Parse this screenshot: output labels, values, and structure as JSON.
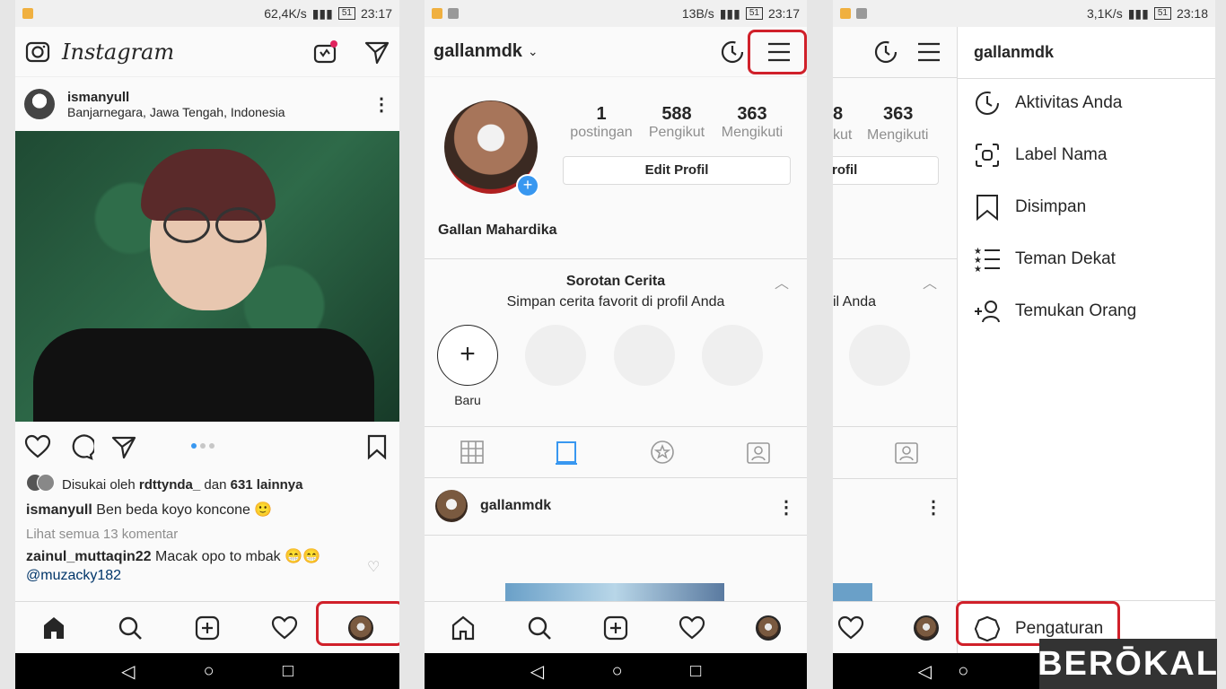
{
  "panel1": {
    "status": {
      "speed": "62,4K/s",
      "battery": "51",
      "time": "23:17"
    },
    "header": {
      "logo": "Instagram"
    },
    "post": {
      "username": "ismanyull",
      "location": "Banjarnegara, Jawa Tengah, Indonesia",
      "likes_prefix": "Disukai oleh",
      "likes_user": "rdttynda_",
      "likes_mid": "dan",
      "likes_count": "631 lainnya",
      "caption_user": "ismanyull",
      "caption_text": "Ben beda koyo koncone 🙂",
      "view_comments": "Lihat semua 13 komentar",
      "comment_user": "zainul_muttaqin22",
      "comment_text": "Macak opo to mbak 😁😁",
      "comment_mention": "@muzacky182"
    }
  },
  "panel2": {
    "status": {
      "speed": "13B/s",
      "battery": "51",
      "time": "23:17"
    },
    "header": {
      "username": "gallanmdk"
    },
    "stats": [
      {
        "value": "1",
        "label": "postingan"
      },
      {
        "value": "588",
        "label": "Pengikut"
      },
      {
        "value": "363",
        "label": "Mengikuti"
      }
    ],
    "edit_button": "Edit Profil",
    "full_name": "Gallan Mahardika",
    "highlights": {
      "title": "Sorotan Cerita",
      "subtitle": "Simpan cerita favorit di profil Anda",
      "new_label": "Baru"
    },
    "post_username": "gallanmdk"
  },
  "panel3": {
    "status": {
      "speed": "3,1K/s",
      "battery": "51",
      "time": "23:18"
    },
    "partial": {
      "stat_value_a": "8",
      "stat_value": "363",
      "stat_label_a": "kut",
      "stat_label": "Mengikuti",
      "edit_partial": "rofil",
      "subtitle_partial": "il Anda"
    },
    "drawer": {
      "username": "gallanmdk",
      "items": [
        {
          "label": "Aktivitas Anda",
          "icon": "activity-clock-icon"
        },
        {
          "label": "Label Nama",
          "icon": "nametag-icon"
        },
        {
          "label": "Disimpan",
          "icon": "bookmark-icon"
        },
        {
          "label": "Teman Dekat",
          "icon": "close-friends-icon"
        },
        {
          "label": "Temukan Orang",
          "icon": "add-person-icon"
        }
      ],
      "settings": "Pengaturan"
    }
  },
  "watermark": "BERŌKAL",
  "colors": {
    "accent": "#3897f0",
    "highlight_box": "#d0202a"
  }
}
